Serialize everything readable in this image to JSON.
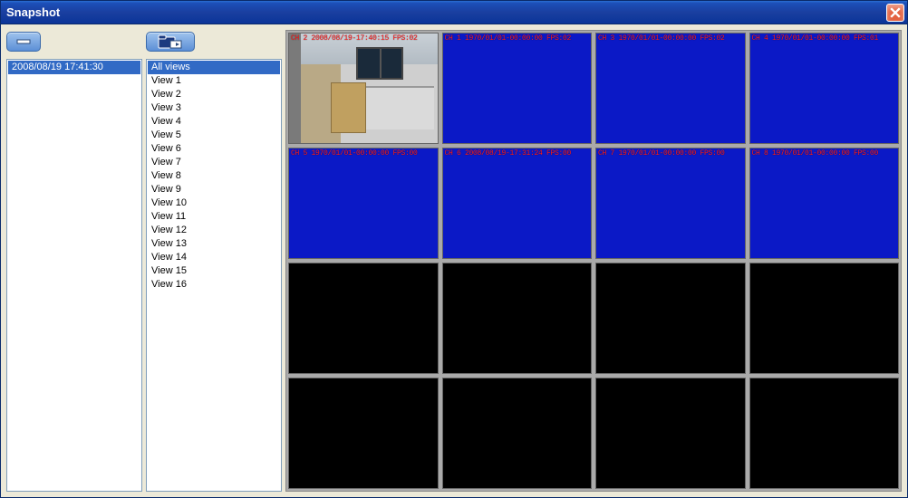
{
  "window": {
    "title": "Snapshot"
  },
  "left": {
    "collapse_button": "collapse",
    "timestamps": [
      "2008/08/19 17:41:30"
    ],
    "selected_index": 0
  },
  "mid": {
    "export_button": "export",
    "views": [
      "All views",
      "View 1",
      "View 2",
      "View 3",
      "View 4",
      "View 5",
      "View 6",
      "View 7",
      "View 8",
      "View 9",
      "View 10",
      "View 11",
      "View 12",
      "View 13",
      "View 14",
      "View 15",
      "View 16"
    ],
    "selected_index": 0
  },
  "grid": {
    "cells": [
      {
        "overlay": "CH 2 2008/08/19-17:40:15 FPS:02",
        "bg": "thumb"
      },
      {
        "overlay": "CH 1 1970/01/01-00:00:00 FPS:02",
        "bg": "blue"
      },
      {
        "overlay": "CH 3 1970/01/01-00:00:00 FPS:02",
        "bg": "blue"
      },
      {
        "overlay": "CH 4 1970/01/01-00:00:00 FPS:01",
        "bg": "blue"
      },
      {
        "overlay": "CH 5 1970/01/01-00:00:00 FPS:00",
        "bg": "blue"
      },
      {
        "overlay": "CH 6 2008/08/19-17:31:24 FPS:00",
        "bg": "blue"
      },
      {
        "overlay": "CH 7 1970/01/01-00:00:00 FPS:00",
        "bg": "blue"
      },
      {
        "overlay": "CH 8 1970/01/01-00:00:00 FPS:00",
        "bg": "blue"
      },
      {
        "overlay": "",
        "bg": "black"
      },
      {
        "overlay": "",
        "bg": "black"
      },
      {
        "overlay": "",
        "bg": "black"
      },
      {
        "overlay": "",
        "bg": "black"
      },
      {
        "overlay": "",
        "bg": "black"
      },
      {
        "overlay": "",
        "bg": "black"
      },
      {
        "overlay": "",
        "bg": "black"
      },
      {
        "overlay": "",
        "bg": "black"
      }
    ]
  }
}
